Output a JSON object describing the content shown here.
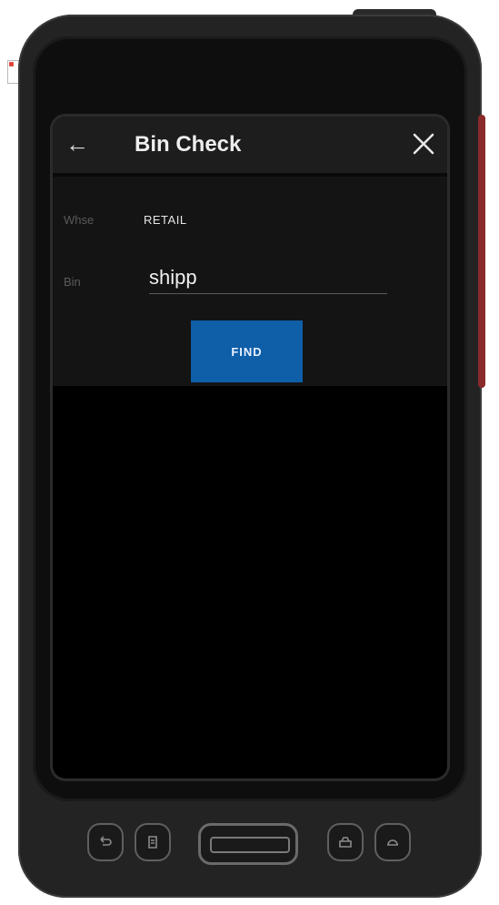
{
  "header": {
    "title": "Bin Check",
    "back_icon": "arrow-left-icon",
    "close_icon": "close-icon"
  },
  "form": {
    "warehouse_label": "Whse",
    "warehouse_value": "RETAIL",
    "bin_label": "Bin",
    "bin_value": "shipp",
    "find_label": "FIND"
  },
  "colors": {
    "accent": "#0e5ea8",
    "header_bg": "#1d1d1d",
    "screen_bg": "#000000"
  },
  "hardware_keys": [
    "back-key-icon",
    "menu-key-icon",
    "scan-trigger",
    "phone-key-icon",
    "home-key-icon"
  ]
}
